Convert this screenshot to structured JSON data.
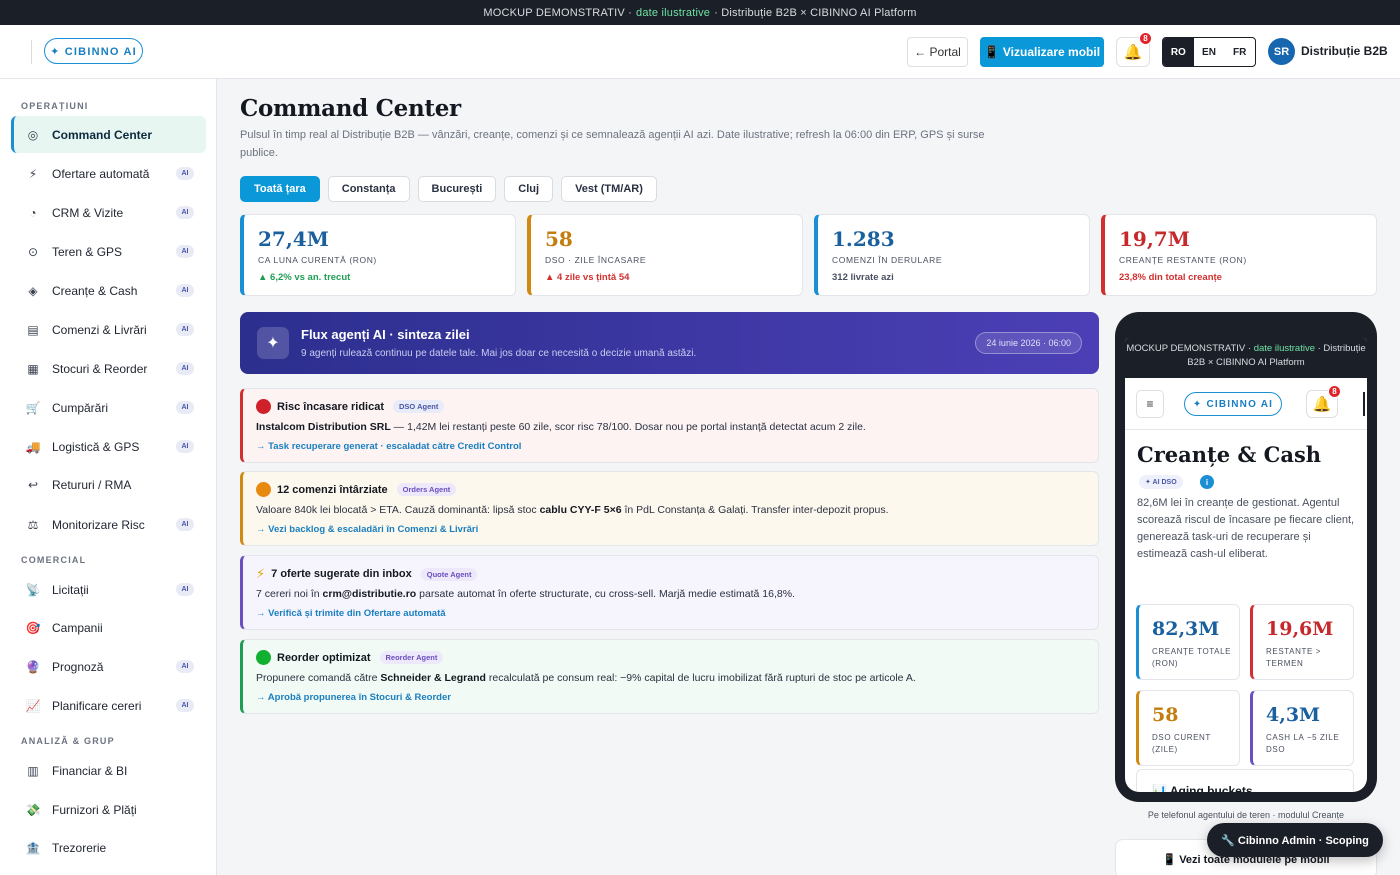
{
  "banner": {
    "prefix": "MOCKUP DEMONSTRATIV ·",
    "highlight": "date ilustrative",
    "suffix": "· Distribuție B2B × CIBINNO AI Platform"
  },
  "header": {
    "logo": "✦ CIBINNO AI",
    "portal_label": "← Portal",
    "mobile_label": "Vizualizare mobil",
    "mobile_icon": "📱",
    "notifications": "8",
    "languages": [
      "RO",
      "EN",
      "FR"
    ],
    "active_language": "RO",
    "avatar_initials": "SR",
    "tenant_name": "Distribuție B2B"
  },
  "sidebar": {
    "sections": [
      "OPERAȚIUNI",
      "COMERCIAL",
      "ANALIZĂ & GRUP"
    ],
    "ai_badge": "AI",
    "items": [
      {
        "label": "Command Center",
        "icon": "◎",
        "ai": false,
        "active": true
      },
      {
        "label": "Ofertare automată",
        "icon": "⚡",
        "ai": true
      },
      {
        "label": "CRM & Vizite",
        "icon": "◔",
        "ai": true
      },
      {
        "label": "Teren & GPS",
        "icon": "⊙",
        "ai": true
      },
      {
        "label": "Creanțe & Cash",
        "icon": "◈",
        "ai": true
      },
      {
        "label": "Comenzi & Livrări",
        "icon": "▤",
        "ai": true
      },
      {
        "label": "Stocuri & Reorder",
        "icon": "▦",
        "ai": true
      },
      {
        "label": "Cumpărări",
        "icon": "🛒",
        "ai": true
      },
      {
        "label": "Logistică & GPS",
        "icon": "🚚",
        "ai": true
      },
      {
        "label": "Retururi / RMA",
        "icon": "↩",
        "ai": false
      },
      {
        "label": "Monitorizare Risc",
        "icon": "⚖",
        "ai": true
      },
      {
        "label": "Licitații",
        "icon": "📡",
        "ai": true
      },
      {
        "label": "Campanii",
        "icon": "🎯",
        "ai": false
      },
      {
        "label": "Prognoză",
        "icon": "🔮",
        "ai": true
      },
      {
        "label": "Planificare cereri",
        "icon": "📈",
        "ai": true
      },
      {
        "label": "Financiar & BI",
        "icon": "▥",
        "ai": false
      },
      {
        "label": "Furnizori & Plăți",
        "icon": "💸",
        "ai": false
      },
      {
        "label": "Trezorerie",
        "icon": "🏦",
        "ai": false
      }
    ]
  },
  "main": {
    "title": "Command Center",
    "subtitle": "Pulsul în timp real al Distribuție B2B — vânzări, creanțe, comenzi și ce semnalează agenții AI azi. Date ilustrative; refresh la 06:00 din ERP, GPS și surse publice.",
    "tabs": [
      "Toată țara",
      "Constanța",
      "București",
      "Cluj",
      "Vest (TM/AR)"
    ],
    "active_tab": "Toată țara",
    "kpis": [
      {
        "value": "27,4M",
        "label": "CA LUNA CURENTĂ (RON)",
        "delta": "▲ 6,2% vs an. trecut",
        "color": "#1a8fd4",
        "value_color": "#1a5f9e",
        "delta_color": "#1f9d55"
      },
      {
        "value": "58",
        "label": "DSO · ZILE ÎNCASARE",
        "delta": "▲ 4 zile vs țintă 54",
        "color": "#d08a12",
        "value_color": "#c27d0e",
        "delta_color": "#d0302f"
      },
      {
        "value": "1.283",
        "label": "COMENZI ÎN DERULARE",
        "delta": "312 livrate azi",
        "color": "#1a8fd4",
        "value_color": "#1a5f9e",
        "delta_color": "#4a5060"
      },
      {
        "value": "19,7M",
        "label": "CREANȚE RESTANTE (RON)",
        "delta": "23,8% din total creanțe",
        "color": "#d0302f",
        "value_color": "#c7282b",
        "delta_color": "#d0302f"
      }
    ],
    "hero": {
      "icon": "✦",
      "title": "Flux agenți AI · sinteza zilei",
      "subtitle": "9 agenți rulează continuu pe datele tale. Mai jos doar ce necesită o decizie umană astăzi.",
      "date": "24 iunie 2026 · 06:00"
    },
    "alerts": [
      {
        "title": "Risc încasare ridicat",
        "tag": "DSO Agent",
        "b1": "Instalcom Distribution SRL",
        "t1": " — 1,42M lei restanți peste 60 zile, scor risc 78/100. Dosar nou pe portal instanță detectat acum 2 zile.",
        "b2": "",
        "t2": "",
        "b3": "",
        "t3": "",
        "link": "→ Task recuperare generat · escaladat către Credit Control",
        "accent": "#d0302f",
        "bg": "#fdf3f3",
        "dot": "#d0202a",
        "tag_bg": "#e8ebf8",
        "tag_fg": "#4a57a8"
      },
      {
        "title": "12 comenzi întârziate",
        "tag": "Orders Agent",
        "b1": "",
        "t1": "Valoare 840k lei blocată > ETA. Cauză dominantă: lipsă stoc ",
        "b2": "cablu CYY-F 5×6",
        "t2": " în PdL Constanța & Galați. Transfer inter-depozit propus.",
        "b3": "",
        "t3": "",
        "link": "→ Vezi backlog & escaladări în Comenzi & Livrări",
        "accent": "#d08a12",
        "bg": "#fdf8ee",
        "dot": "#e88a10",
        "tag_bg": "#ede9fb",
        "tag_fg": "#6a4fc0"
      },
      {
        "title": "7 oferte sugerate din inbox",
        "tag": "Quote Agent",
        "b1": "",
        "t1": "7 cereri noi în ",
        "b2": "crm@distributie.ro",
        "t2": " parsate automat în oferte structurate, cu cross-sell. Marjă medie estimată 16,8%.",
        "b3": "",
        "t3": "",
        "link": "→ Verifică și trimite din Ofertare automată",
        "accent": "#6a4fc0",
        "bg": "#f6f4fd",
        "dot": "",
        "tag_bg": "#ede9fb",
        "tag_fg": "#6a4fc0"
      },
      {
        "title": "Reorder optimizat",
        "tag": "Reorder Agent",
        "b1": "",
        "t1": "Propunere comandă către ",
        "b2": "Schneider & Legrand",
        "t2": " recalculată pe consum real: −9% capital de lucru imobilizat fără rupturi de stoc pe articole A.",
        "b3": "",
        "t3": "",
        "link": "→ Aprobă propunerea în Stocuri & Reorder",
        "accent": "#1f9d55",
        "bg": "#f1faf5",
        "dot": "#12b031",
        "tag_bg": "#ede9fb",
        "tag_fg": "#6a4fc0"
      }
    ],
    "alert_bolt_icon": "⚡"
  },
  "phone": {
    "banner_prefix": "MOCKUP DEMONSTRATIV ·",
    "banner_highlight": "date ilustrative",
    "banner_suffix": "· Distribuție B2B × CIBINNO AI Platform",
    "menu_icon": "≡",
    "logo": "✦ CIBINNO AI",
    "notifications": "8",
    "title": "Creanțe & Cash",
    "chip": "✦ AI DSO",
    "info_icon": "i",
    "description": "82,6M lei în creanțe de gestionat. Agentul scorează riscul de încasare pe fiecare client, generează task-uri de recuperare și estimează cash-ul eliberat.",
    "kpis": [
      {
        "value": "82,3M",
        "label": "CREANȚE TOTALE (RON)",
        "color": "#1a8fd4",
        "value_color": "#1a5f9e"
      },
      {
        "value": "19,6M",
        "label": "RESTANTE > TERMEN",
        "color": "#d0302f",
        "value_color": "#c7282b"
      },
      {
        "value": "58",
        "label": "DSO CURENT (ZILE)",
        "color": "#d08a12",
        "value_color": "#c27d0e"
      },
      {
        "value": "4,3M",
        "label": "CASH LA −5 ZILE DSO",
        "color": "#6a4fc0",
        "value_color": "#1a5f9e"
      }
    ],
    "aging_title": "📊 Aging buckets",
    "caption": "Pe telefonul agentului de teren · modulul Creanțe",
    "all_modules": "📱 Vezi toate modulele pe mobil"
  },
  "admin_button": "🔧 Cibinno Admin · Scoping"
}
